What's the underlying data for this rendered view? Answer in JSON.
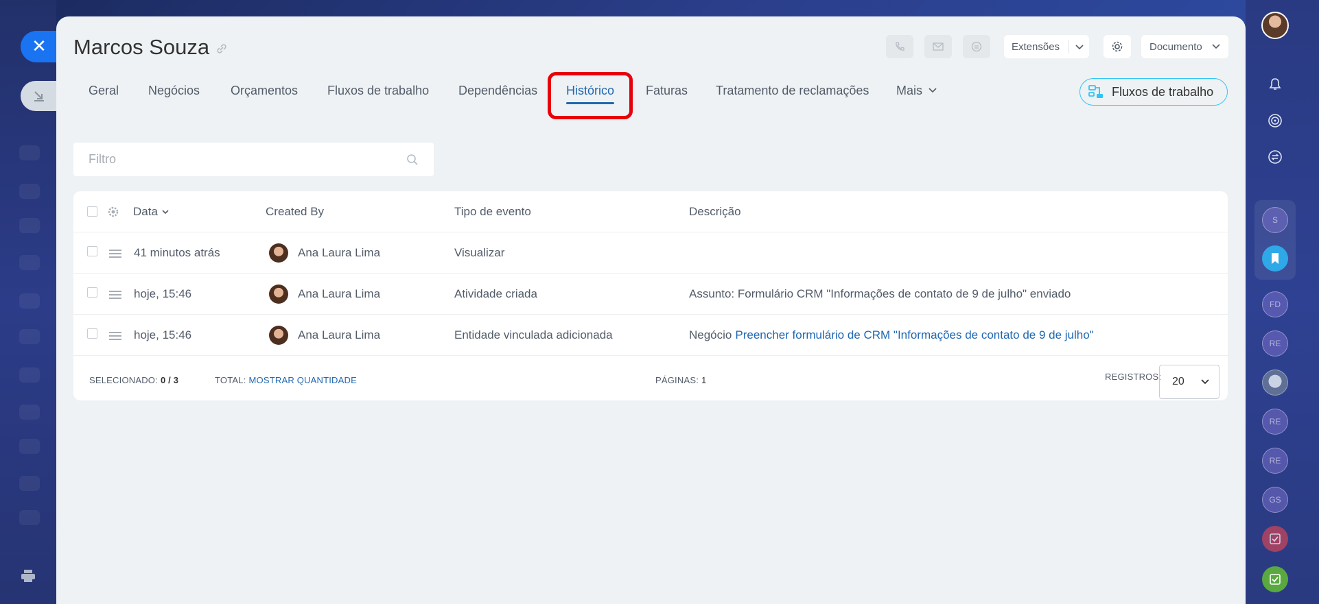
{
  "header": {
    "title": "Marcos Souza",
    "extensions_label": "Extensões",
    "document_label": "Documento"
  },
  "tabs": [
    {
      "label": "Geral"
    },
    {
      "label": "Negócios"
    },
    {
      "label": "Orçamentos"
    },
    {
      "label": "Fluxos de trabalho"
    },
    {
      "label": "Dependências"
    },
    {
      "label": "Histórico",
      "active": true
    },
    {
      "label": "Faturas"
    },
    {
      "label": "Tratamento de reclamações"
    },
    {
      "label": "Mais"
    }
  ],
  "workflows_button": "Fluxos de trabalho",
  "filter": {
    "placeholder": "Filtro"
  },
  "table": {
    "columns": [
      "Data",
      "Created By",
      "Tipo de evento",
      "Descrição"
    ],
    "rows": [
      {
        "date": "41 minutos atrás",
        "user": "Ana Laura Lima",
        "event": "Visualizar",
        "desc_prefix": "",
        "desc_link": "",
        "desc": ""
      },
      {
        "date": "hoje, 15:46",
        "user": "Ana Laura Lima",
        "event": "Atividade criada",
        "desc_prefix": "",
        "desc_link": "",
        "desc": "Assunto: Formulário CRM \"Informações de contato de 9 de julho\" enviado"
      },
      {
        "date": "hoje, 15:46",
        "user": "Ana Laura Lima",
        "event": "Entidade vinculada adicionada",
        "desc_prefix": "Negócio",
        "desc_link": "Preencher formulário de CRM \"Informações de contato de 9 de julho\"",
        "desc": ""
      }
    ]
  },
  "footer": {
    "selected_label": "SELECIONADO:",
    "selected_value": "0 / 3",
    "total_label": "TOTAL:",
    "total_link": "MOSTRAR QUANTIDADE",
    "pages_label": "PÁGINAS:",
    "pages_value": "1",
    "records_label": "REGISTROS:",
    "records_value": "20"
  },
  "right_sidebar": {
    "avatars": [
      "S",
      "FD",
      "RE",
      "RE",
      "RE",
      "GS"
    ]
  },
  "colors": {
    "accent": "#2067b0",
    "close_button": "#1a73f0",
    "highlight": "#e8000b",
    "workflow_border": "#2fc6f6"
  }
}
